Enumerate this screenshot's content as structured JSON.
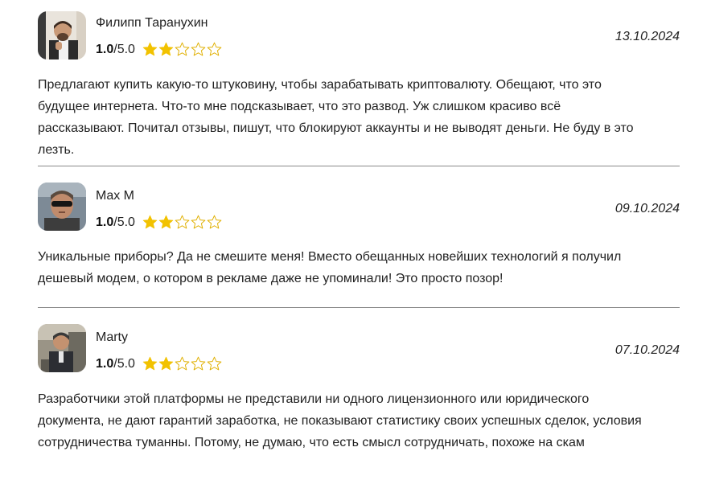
{
  "colors": {
    "star_filled": "#f2c200",
    "star_outline": "#e0b000",
    "divider": "#8a8a8a",
    "text": "#222222"
  },
  "reviews": [
    {
      "author": "Филипп Таранухин",
      "rating_value": "1.0",
      "rating_scale": "/5.0",
      "stars_filled": 2,
      "stars_total": 5,
      "date": "13.10.2024",
      "text": "Предлагают купить какую-то штуковину, чтобы зарабатывать криптовалюту. Обещают, что это будущее интернета. Что-то мне подсказывает, что это развод. Уж слишком красиво всё рассказывают. Почитал отзывы, пишут, что блокируют аккаунты и не выводят деньги. Не буду в это лезть."
    },
    {
      "author": "Max M",
      "rating_value": "1.0",
      "rating_scale": "/5.0",
      "stars_filled": 2,
      "stars_total": 5,
      "date": "09.10.2024",
      "text": "Уникальные приборы? Да не смешите меня! Вместо обещанных новейших технологий я получил дешевый модем, о котором в рекламе даже не упоминали! Это просто позор!"
    },
    {
      "author": "Marty",
      "rating_value": "1.0",
      "rating_scale": "/5.0",
      "stars_filled": 2,
      "stars_total": 5,
      "date": "07.10.2024",
      "text": "Разработчики этой платформы не представили ни одного лицензионного или юридического документа, не дают гарантий заработка, не показывают статистику своих успешных сделок, условия сотрудничества туманны. Потому, не думаю, что есть смысл сотрудничать, похоже на скам"
    }
  ]
}
